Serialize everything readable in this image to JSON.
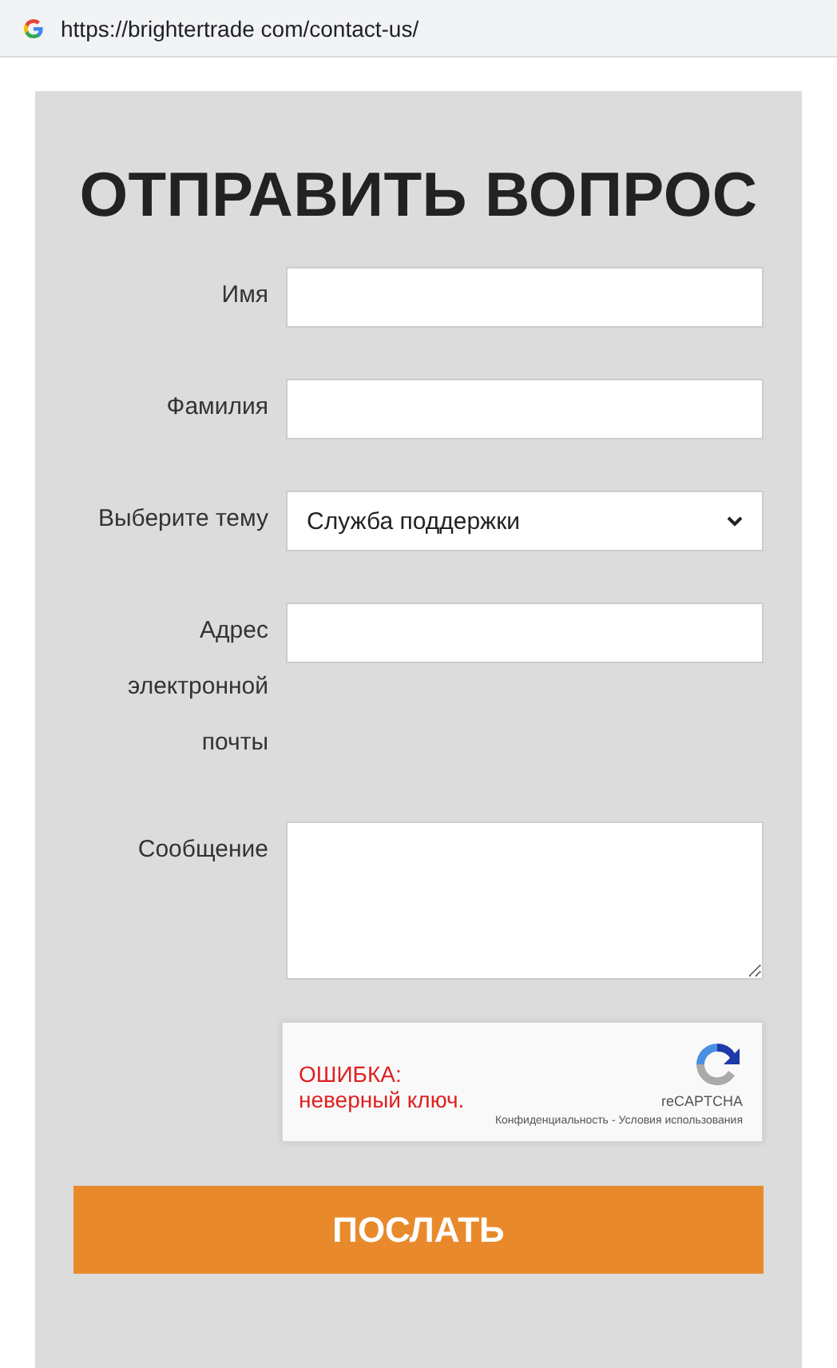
{
  "address_bar": {
    "url": "https://brightertrade com/contact-us/"
  },
  "form": {
    "title": "ОТПРАВИТЬ ВОПРОС",
    "fields": [
      {
        "kind": "text",
        "label": "Имя"
      },
      {
        "kind": "text",
        "label": "Фамилия"
      },
      {
        "kind": "select",
        "label": "Выберите тему",
        "value": "Служба поддержки"
      },
      {
        "kind": "text",
        "label": "Адрес электронной почты"
      },
      {
        "kind": "textarea",
        "label": "Сообщение"
      }
    ],
    "captcha": {
      "error": "ОШИБКА: неверный ключ.",
      "brand": "reCAPTCHA",
      "privacy": "Конфиденциальность",
      "separator": "-",
      "terms": "Условия использования"
    },
    "submit": "ПОСЛАТЬ"
  }
}
